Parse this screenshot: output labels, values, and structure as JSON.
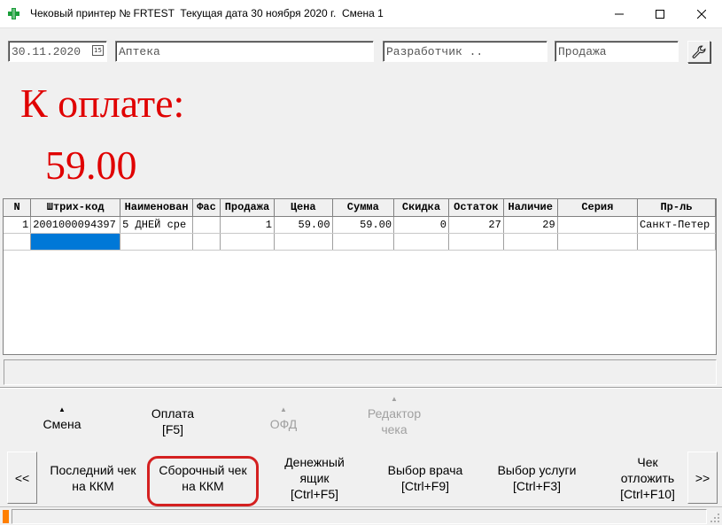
{
  "window": {
    "title": "Чековый принтер № FRTEST  Текущая дата 30 ноября 2020 г.  Смена 1",
    "minimize_label": "—",
    "maximize_label": "☐",
    "close_label": "✕"
  },
  "topbar": {
    "date_value": "30.11.2020",
    "calendar_icon_label": "15",
    "organization": "Аптека",
    "user": "Разработчик ..",
    "mode": "Продажа",
    "settings_icon": "wrench-icon"
  },
  "payment": {
    "label": "К оплате:",
    "amount": "59.00",
    "color": "#e00000"
  },
  "table": {
    "columns": [
      "N",
      "Штрих-код",
      "Наименован",
      "Фас",
      "Продажа",
      "Цена",
      "Сумма",
      "Скидка",
      "Остаток",
      "Наличие",
      "Серия",
      "Пр-ль"
    ],
    "rows": [
      [
        "1",
        "2001000094397",
        "5 ДНЕЙ сре",
        "",
        "1",
        "59.00",
        "59.00",
        "0",
        "27",
        "29",
        "",
        "Санкт-Петер"
      ]
    ]
  },
  "toolbar": {
    "shift": {
      "label": "Смена"
    },
    "payment": {
      "label": "Оплата",
      "shortcut": "[F5]"
    },
    "ofd": {
      "label": "ОФД"
    },
    "receipt_editor": {
      "label": "Редактор",
      "label2": "чека"
    }
  },
  "bottom_buttons": {
    "prev": "<<",
    "last_receipt": {
      "line1": "Последний чек",
      "line2": "на ККМ"
    },
    "summary_receipt": {
      "line1": "Сборочный чек",
      "line2": "на ККМ"
    },
    "cash_drawer": {
      "line1": "Денежный",
      "line2": "ящик",
      "line3": "[Ctrl+F5]"
    },
    "doctor_select": {
      "line1": "Выбор врача",
      "line2": "[Ctrl+F9]"
    },
    "service_select": {
      "line1": "Выбор услуги",
      "line2": "[Ctrl+F3]"
    },
    "defer_receipt": {
      "line1": "Чек",
      "line2": "отложить",
      "line3": "[Ctrl+F10]"
    },
    "next": ">>"
  },
  "colors": {
    "highlight": "#d42020",
    "selection": "#0078d7",
    "status_mark": "#ff7f00",
    "app_icon": "#1a9e3a"
  }
}
